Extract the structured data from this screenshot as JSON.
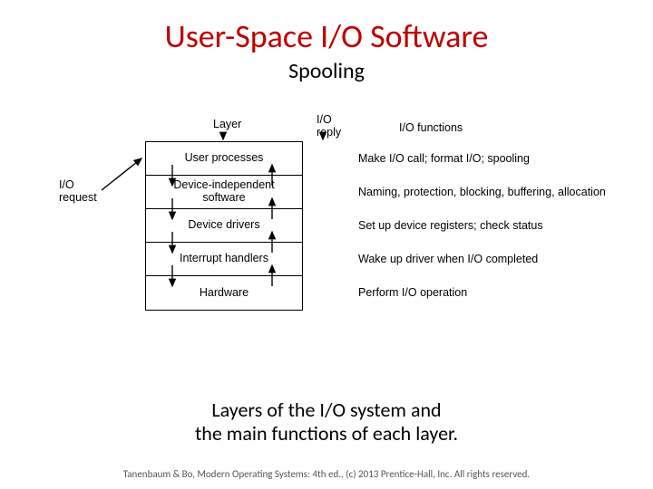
{
  "title": "User-Space I/O Software",
  "subtitle": "Spooling",
  "diagram": {
    "header_layer": "Layer",
    "header_io_reply": "I/O\nreply",
    "header_io_functions": "I/O functions",
    "io_request": "I/O\nrequest",
    "layers": [
      {
        "name": "User processes",
        "fn": "Make I/O call; format I/O; spooling"
      },
      {
        "name": "Device-independent\nsoftware",
        "fn": "Naming, protection, blocking, buffering, allocation"
      },
      {
        "name": "Device drivers",
        "fn": "Set up device registers; check status"
      },
      {
        "name": "Interrupt handlers",
        "fn": "Wake up driver when I/O completed"
      },
      {
        "name": "Hardware",
        "fn": "Perform I/O operation"
      }
    ]
  },
  "caption_line1": "Layers of the I/O system and",
  "caption_line2": "the main functions of each layer.",
  "footer": "Tanenbaum & Bo, Modern Operating Systems: 4th ed., (c) 2013 Prentice-Hall, Inc. All rights reserved."
}
